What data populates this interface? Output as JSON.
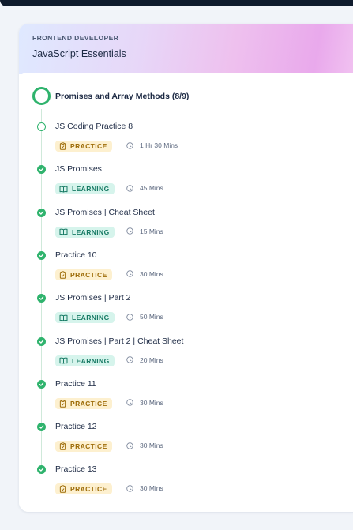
{
  "header": {
    "kicker": "FRONTEND DEVELOPER",
    "course_title": "JavaScript Essentials"
  },
  "section": {
    "title": "Promises and Array Methods (8/9)"
  },
  "items": [
    {
      "title": "JS Coding Practice 8",
      "type": "PRACTICE",
      "duration": "1 Hr 30 Mins",
      "completed": false
    },
    {
      "title": "JS Promises",
      "type": "LEARNING",
      "duration": "45 Mins",
      "completed": true
    },
    {
      "title": "JS Promises | Cheat Sheet",
      "type": "LEARNING",
      "duration": "15 Mins",
      "completed": true
    },
    {
      "title": "Practice 10",
      "type": "PRACTICE",
      "duration": "30 Mins",
      "completed": true
    },
    {
      "title": "JS Promises | Part 2",
      "type": "LEARNING",
      "duration": "50 Mins",
      "completed": true
    },
    {
      "title": "JS Promises | Part 2 | Cheat Sheet",
      "type": "LEARNING",
      "duration": "20 Mins",
      "completed": true
    },
    {
      "title": "Practice 11",
      "type": "PRACTICE",
      "duration": "30 Mins",
      "completed": true
    },
    {
      "title": "Practice 12",
      "type": "PRACTICE",
      "duration": "30 Mins",
      "completed": true
    },
    {
      "title": "Practice 13",
      "type": "PRACTICE",
      "duration": "30 Mins",
      "completed": true
    }
  ],
  "icons": {
    "completed": "check-circle-icon",
    "in_progress": "empty-circle-icon",
    "practice": "clipboard-icon",
    "learning": "book-open-icon",
    "duration": "clock-icon"
  },
  "colors": {
    "accent_green": "#2fb36d",
    "practice_bg": "#fdf0cf",
    "practice_text": "#9c6a06",
    "learning_bg": "#d6f4ec",
    "learning_text": "#177a64"
  }
}
